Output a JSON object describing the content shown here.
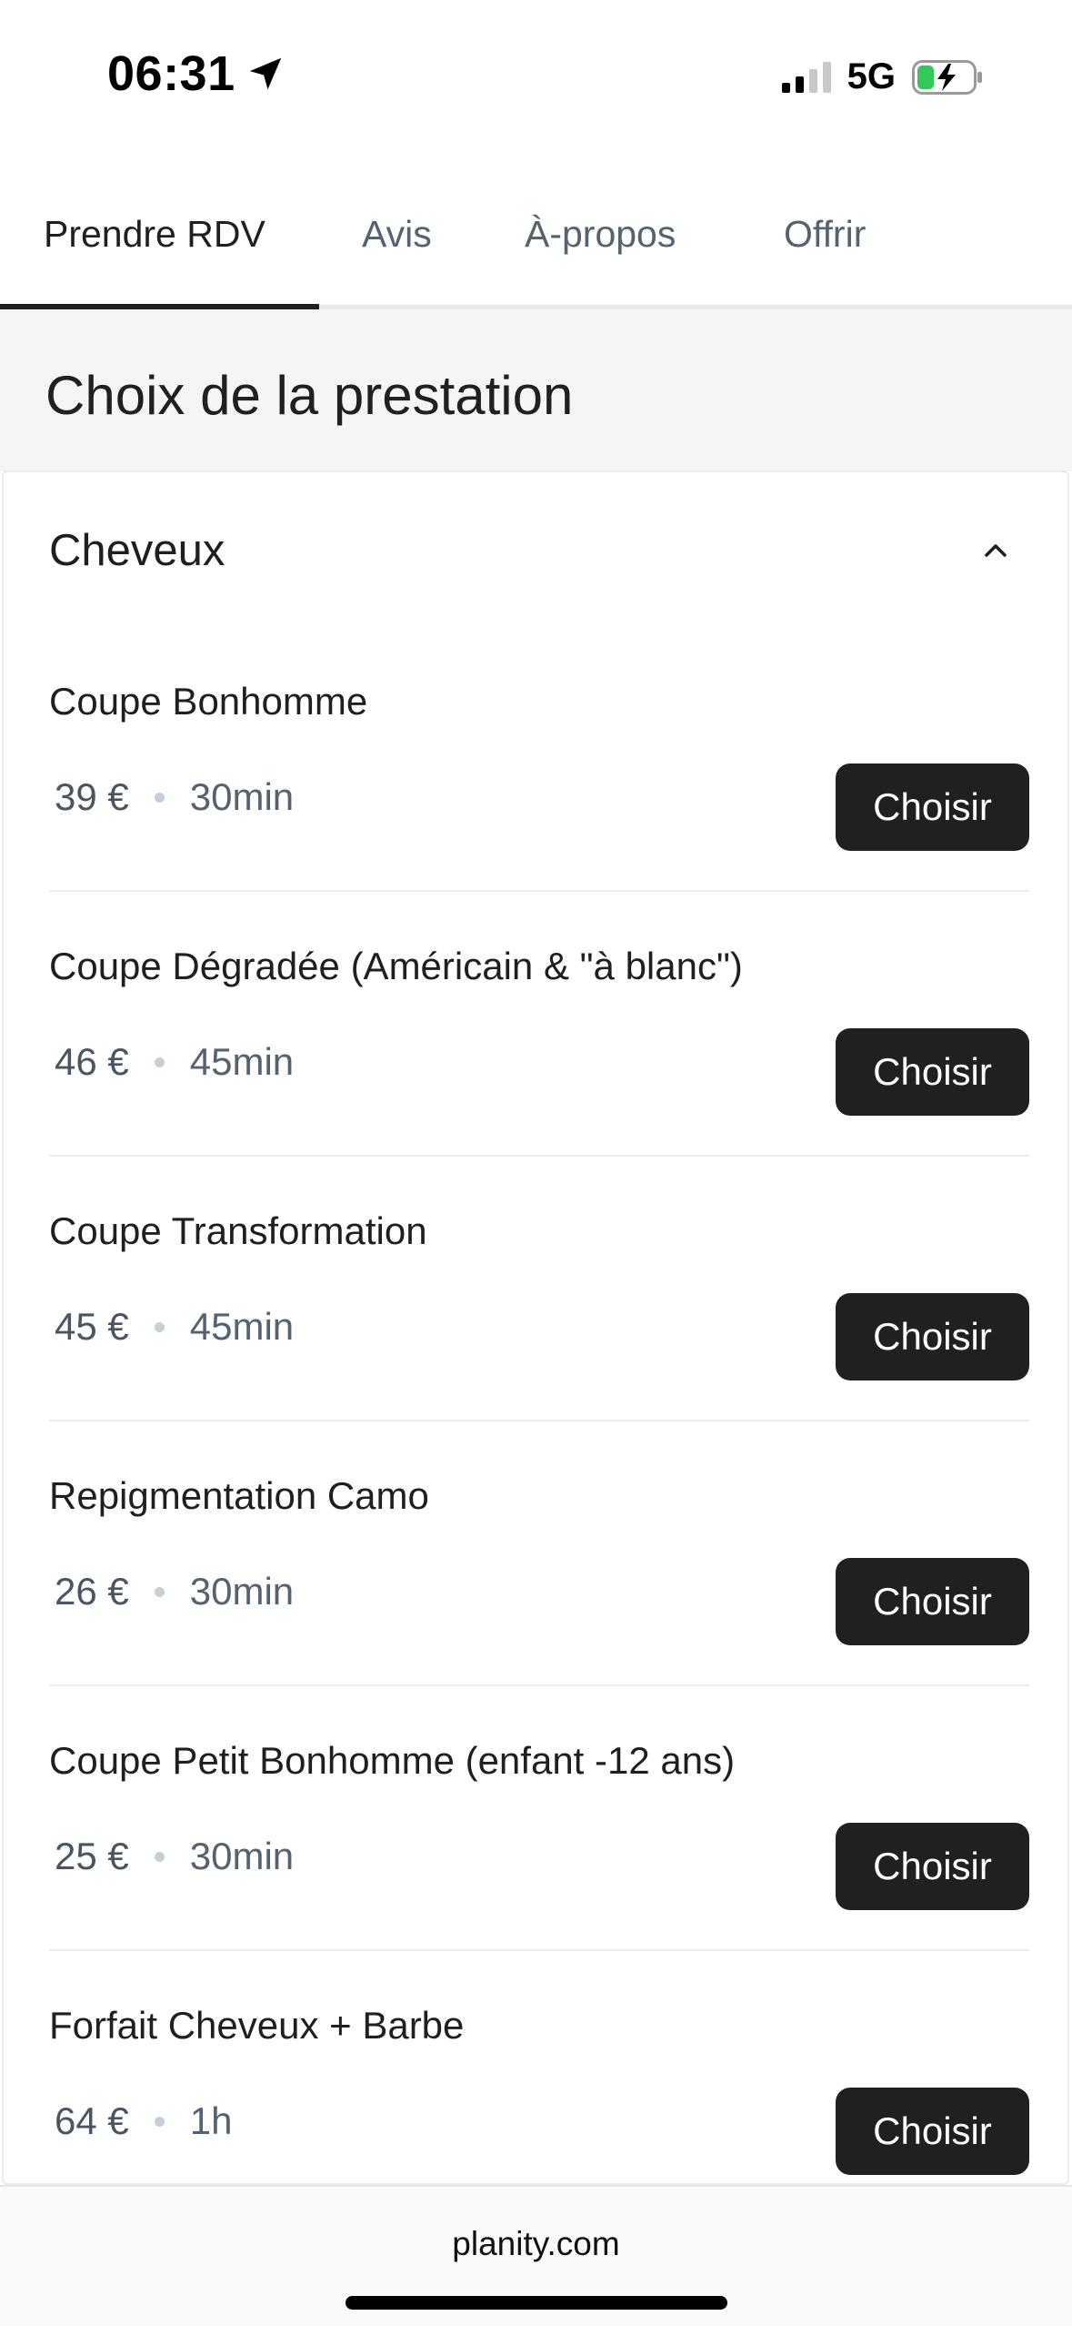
{
  "status_bar": {
    "time": "06:31",
    "network": "5G"
  },
  "tabs": [
    {
      "label": "Prendre RDV",
      "active": true
    },
    {
      "label": "Avis",
      "active": false
    },
    {
      "label": "À-propos",
      "active": false
    },
    {
      "label": "Offrir",
      "active": false
    }
  ],
  "page_title": "Choix de la prestation",
  "category": {
    "title": "Cheveux",
    "expanded": true
  },
  "services": [
    {
      "name": "Coupe Bonhomme",
      "price": "39 €",
      "duration": "30min",
      "button": "Choisir"
    },
    {
      "name": "Coupe Dégradée (Américain & \"à blanc\")",
      "price": "46 €",
      "duration": "45min",
      "button": "Choisir"
    },
    {
      "name": "Coupe Transformation",
      "price": "45 €",
      "duration": "45min",
      "button": "Choisir"
    },
    {
      "name": "Repigmentation Camo",
      "price": "26 €",
      "duration": "30min",
      "button": "Choisir"
    },
    {
      "name": "Coupe Petit Bonhomme (enfant -12 ans)",
      "price": "25 €",
      "duration": "30min",
      "button": "Choisir"
    },
    {
      "name": "Forfait Cheveux + Barbe",
      "price": "64 €",
      "duration": "1h",
      "button": "Choisir"
    }
  ],
  "url_bar": {
    "domain": "planity.com"
  },
  "colors": {
    "button_bg": "#202020",
    "button_text": "#ffffff",
    "muted_text": "#556270",
    "section_bg": "#f5f5f5",
    "battery_charging": "#34c759"
  }
}
